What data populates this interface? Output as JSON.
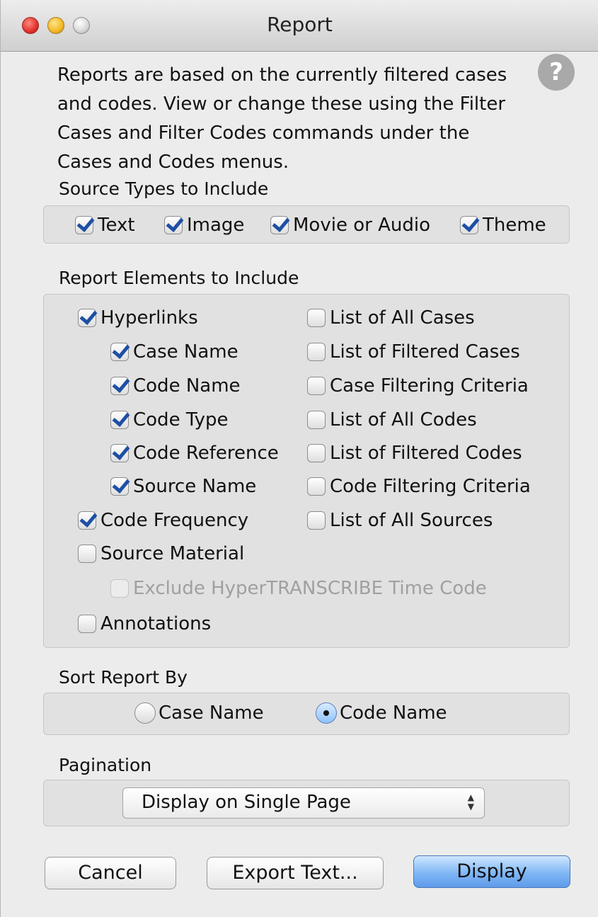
{
  "window": {
    "title": "Report"
  },
  "intro_text": "Reports are based on the currently filtered cases and codes.  View or change these using the Filter Cases and Filter Codes commands under the Cases and Codes menus.",
  "help_icon": {
    "glyph": "?"
  },
  "source_types": {
    "label": "Source Types to Include",
    "items": [
      {
        "label": "Text",
        "checked": true
      },
      {
        "label": "Image",
        "checked": true
      },
      {
        "label": "Movie or Audio",
        "checked": true
      },
      {
        "label": "Theme",
        "checked": true
      }
    ]
  },
  "report_elements": {
    "label": "Report Elements to Include",
    "left": [
      {
        "label": "Hyperlinks",
        "checked": true,
        "enabled": true
      },
      {
        "label": "Case Name",
        "checked": true,
        "enabled": true
      },
      {
        "label": "Code Name",
        "checked": true,
        "enabled": true
      },
      {
        "label": "Code Type",
        "checked": true,
        "enabled": true
      },
      {
        "label": "Code Reference",
        "checked": true,
        "enabled": true
      },
      {
        "label": "Source Name",
        "checked": true,
        "enabled": true
      },
      {
        "label": "Code Frequency",
        "checked": true,
        "enabled": true
      },
      {
        "label": "Source Material",
        "checked": false,
        "enabled": true
      },
      {
        "label": "Exclude HyperTRANSCRIBE Time Code",
        "checked": false,
        "enabled": false
      },
      {
        "label": "Annotations",
        "checked": false,
        "enabled": true
      }
    ],
    "right": [
      {
        "label": "List of All Cases",
        "checked": false
      },
      {
        "label": "List of Filtered Cases",
        "checked": false
      },
      {
        "label": "Case Filtering Criteria",
        "checked": false
      },
      {
        "label": "List of All Codes",
        "checked": false
      },
      {
        "label": "List of Filtered Codes",
        "checked": false
      },
      {
        "label": "Code Filtering Criteria",
        "checked": false
      },
      {
        "label": "List of All Sources",
        "checked": false
      }
    ]
  },
  "sort": {
    "label": "Sort Report By",
    "options": [
      {
        "label": "Case Name",
        "selected": false
      },
      {
        "label": "Code Name",
        "selected": true
      }
    ]
  },
  "pagination": {
    "label": "Pagination",
    "selected": "Display on Single Page",
    "arrow_up": "▲",
    "arrow_down": "▼"
  },
  "buttons": {
    "cancel": "Cancel",
    "export": "Export Text...",
    "display": "Display"
  },
  "colors": {
    "accent": "#1d4fa5",
    "default_button": "#7fb6f5"
  }
}
